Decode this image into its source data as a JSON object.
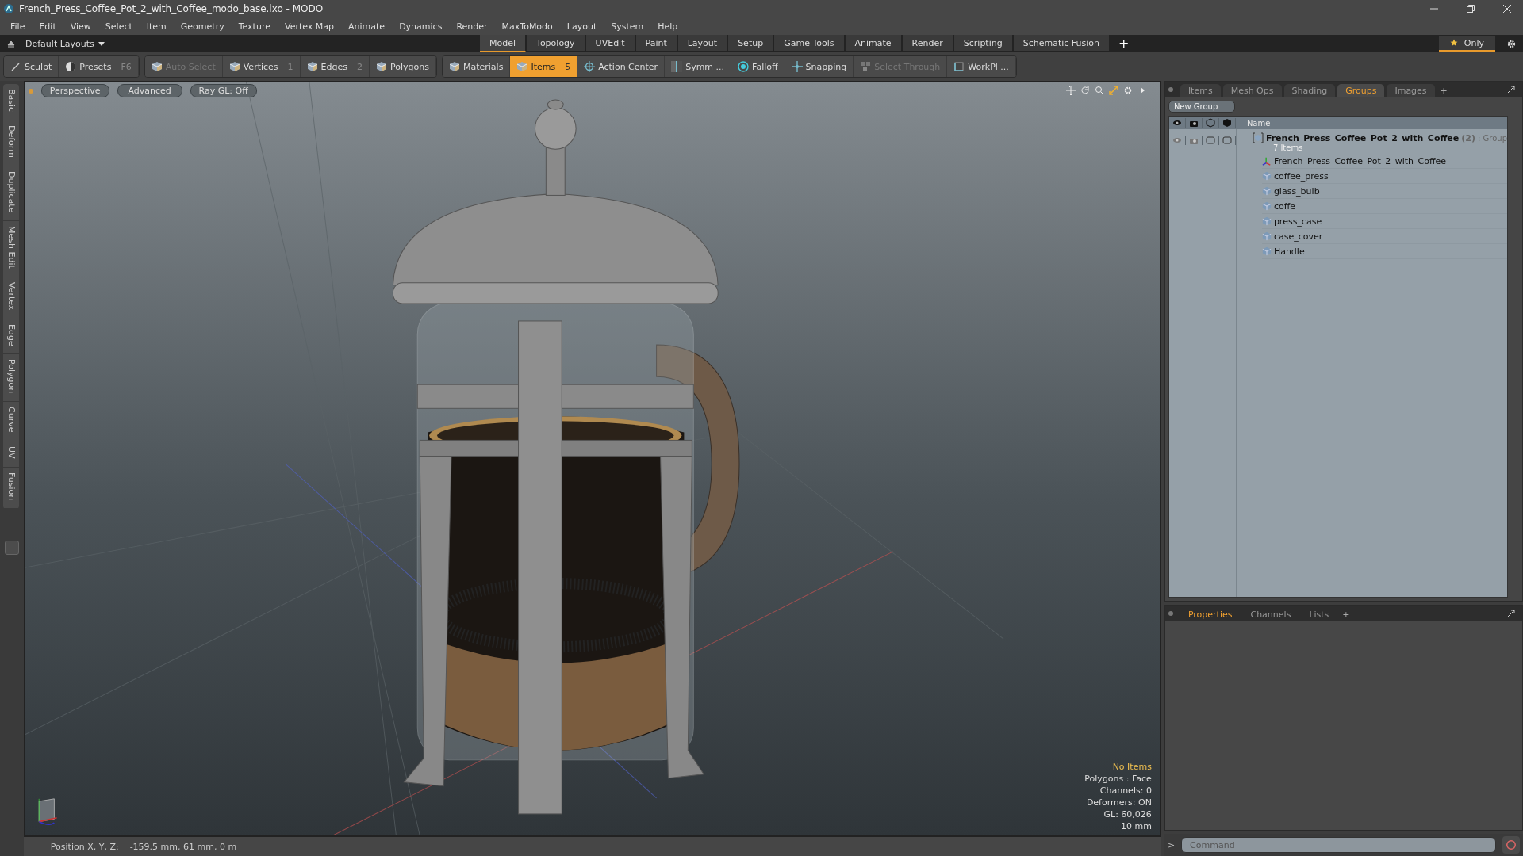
{
  "window": {
    "title": "French_Press_Coffee_Pot_2_with_Coffee_modo_base.lxo - MODO"
  },
  "menu": [
    "File",
    "Edit",
    "View",
    "Select",
    "Item",
    "Geometry",
    "Texture",
    "Vertex Map",
    "Animate",
    "Dynamics",
    "Render",
    "MaxToModo",
    "Layout",
    "System",
    "Help"
  ],
  "layout_bar": {
    "layouts_dropdown": "Default Layouts",
    "tabs": [
      {
        "label": "Model",
        "selected": true
      },
      {
        "label": "Topology",
        "selected": false
      },
      {
        "label": "UVEdit",
        "selected": false
      },
      {
        "label": "Paint",
        "selected": false
      },
      {
        "label": "Layout",
        "selected": false
      },
      {
        "label": "Setup",
        "selected": false
      },
      {
        "label": "Game Tools",
        "selected": false
      },
      {
        "label": "Animate",
        "selected": false
      },
      {
        "label": "Render",
        "selected": false
      },
      {
        "label": "Scripting",
        "selected": false
      },
      {
        "label": "Schematic Fusion",
        "selected": false
      }
    ],
    "add_tab": "+",
    "only_button": "Only"
  },
  "toolbar": [
    [
      {
        "label": "Sculpt",
        "kind": "brush",
        "disabled": false,
        "selected": false
      },
      {
        "label": "Presets",
        "shortcut": "F6",
        "kind": "sphere",
        "disabled": false,
        "selected": false
      }
    ],
    [
      {
        "label": "Auto Select",
        "kind": "cube",
        "disabled": true,
        "selected": false
      },
      {
        "label": "Vertices",
        "shortcut": "1",
        "kind": "cube",
        "disabled": false,
        "selected": false
      },
      {
        "label": "Edges",
        "shortcut": "2",
        "kind": "cube",
        "disabled": false,
        "selected": false
      },
      {
        "label": "Polygons",
        "kind": "cube",
        "disabled": false,
        "selected": false
      }
    ],
    [
      {
        "label": "Materials",
        "kind": "cube",
        "disabled": false,
        "selected": false
      },
      {
        "label": "Items",
        "shortcut": "5",
        "kind": "cube",
        "disabled": false,
        "selected": true
      },
      {
        "label": "Action Center",
        "kind": "target",
        "disabled": false,
        "selected": false
      },
      {
        "label": "Symm ...",
        "kind": "symmetry",
        "disabled": false,
        "selected": false
      },
      {
        "label": "Falloff",
        "kind": "falloff",
        "disabled": false,
        "selected": false
      },
      {
        "label": "Snapping",
        "kind": "snap",
        "disabled": false,
        "selected": false
      },
      {
        "label": "Select Through",
        "kind": "through",
        "disabled": true,
        "selected": false
      },
      {
        "label": "WorkPl ...",
        "kind": "workplane",
        "disabled": false,
        "selected": false
      }
    ]
  ],
  "side_tabs": [
    "Basic",
    "Deform",
    "Duplicate",
    "Mesh Edit",
    "Vertex",
    "Edge",
    "Polygon",
    "Curve",
    "UV",
    "Fusion"
  ],
  "viewport": {
    "header_buttons": [
      "Perspective",
      "Advanced",
      "Ray GL: Off"
    ],
    "info": [
      {
        "text": "No Items",
        "highlight": true
      },
      {
        "text": "Polygons : Face",
        "highlight": false
      },
      {
        "text": "Channels: 0",
        "highlight": false
      },
      {
        "text": "Deformers: ON",
        "highlight": false
      },
      {
        "text": "GL: 60,026",
        "highlight": false
      },
      {
        "text": "10 mm",
        "highlight": false
      }
    ]
  },
  "status_bar": {
    "label": "Position X, Y, Z:",
    "value": "-159.5 mm, 61 mm, 0 m"
  },
  "items_panel": {
    "tabs": [
      {
        "label": "Items",
        "selected": false
      },
      {
        "label": "Mesh Ops",
        "selected": false
      },
      {
        "label": "Shading",
        "selected": false
      },
      {
        "label": "Groups",
        "selected": true
      },
      {
        "label": "Images",
        "selected": false
      }
    ],
    "add_tab": "+",
    "new_group": "New Group",
    "name_header": "Name",
    "group": {
      "name": "French_Press_Coffee_Pot_2_with_Coffee",
      "count": "(2)",
      "type": ": Group",
      "subtitle": "7 Items",
      "children": [
        {
          "name": "French_Press_Coffee_Pot_2_with_Coffee",
          "kind": "locator"
        },
        {
          "name": "coffee_press",
          "kind": "mesh"
        },
        {
          "name": "glass_bulb",
          "kind": "mesh"
        },
        {
          "name": "coffe",
          "kind": "mesh"
        },
        {
          "name": "press_case",
          "kind": "mesh"
        },
        {
          "name": "case_cover",
          "kind": "mesh"
        },
        {
          "name": "Handle",
          "kind": "mesh"
        }
      ]
    }
  },
  "properties_panel": {
    "tabs": [
      {
        "label": "Properties",
        "selected": true
      },
      {
        "label": "Channels",
        "selected": false
      },
      {
        "label": "Lists",
        "selected": false
      }
    ],
    "add_tab": "+"
  },
  "command": {
    "prompt": ">",
    "placeholder": "Command"
  }
}
